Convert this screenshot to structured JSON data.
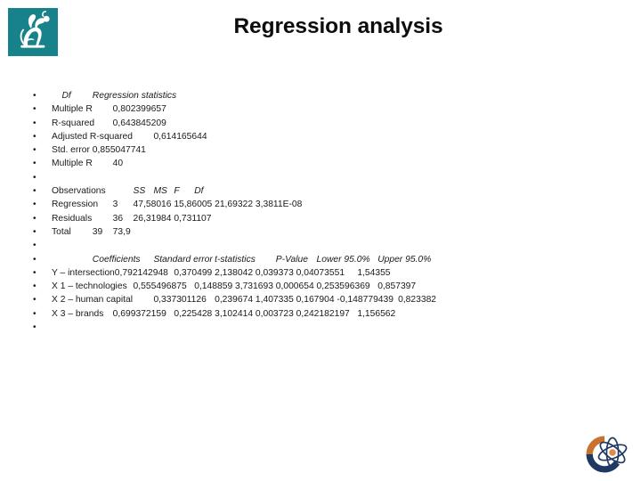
{
  "slide": {
    "title": "Regression analysis",
    "bullet_glyph": "•",
    "brand_logo_name": "griffin-logo",
    "brand_logo_color": "#17828a",
    "corner_logo_name": "atom-circle-logo",
    "corner_logo_colors": {
      "arc_top": "#c8722e",
      "arc_bottom": "#1f3864",
      "nucleus": "#e08a4e"
    },
    "title_color": "#0d0d0d",
    "text_color": "#1a1a1a",
    "background": "#ffffff"
  },
  "content": {
    "rows": [
      {
        "id": "stats-header",
        "style": "italic",
        "text": "    Df\tRegression statistics"
      },
      {
        "id": "multiple-r",
        "style": "normal",
        "text": "Multiple R\t0,802399657"
      },
      {
        "id": "r-squared",
        "style": "normal",
        "text": "R-squared\t0,643845209"
      },
      {
        "id": "adjusted-r-squared",
        "style": "normal",
        "text": "Adjusted R-squared\t0,614165644"
      },
      {
        "id": "std-error",
        "style": "normal",
        "text": "Std. error\t0,855047741"
      },
      {
        "id": "multiple-r-count",
        "style": "normal",
        "text": "Multiple R\t40"
      },
      {
        "id": "spacer-1",
        "style": "normal",
        "text": ""
      },
      {
        "id": "anova-header",
        "style": "mixed",
        "segments": [
          {
            "text": "Observations\t\t",
            "italic": false
          },
          {
            "text": "SS\tMS\tF\tDf",
            "italic": true
          }
        ],
        "text": "Observations\t\tSS\tMS\tF\tDf"
      },
      {
        "id": "anova-regression",
        "style": "normal",
        "text": "Regression\t3\t47,58016\t15,86005\t21,69322\t3,3811E-08"
      },
      {
        "id": "anova-residuals",
        "style": "normal",
        "text": "Residuals\t36\t26,31984\t0,731107"
      },
      {
        "id": "anova-total",
        "style": "normal",
        "text": "Total\t39\t73,9"
      },
      {
        "id": "spacer-2",
        "style": "normal",
        "text": ""
      },
      {
        "id": "coef-header",
        "style": "italic",
        "text": "\t\tCoefficients\tStandard error\tt-statistics\tP-Value\tLower 95.0%\tUpper 95.0%"
      },
      {
        "id": "coef-intersection",
        "style": "normal",
        "text": "Y – intersection0,792142948\t0,370499\t2,138042\t0,039373\t0,04073551\t1,54355"
      },
      {
        "id": "coef-x1",
        "style": "normal",
        "text": "X 1 – technologies\t0,555496875\t0,148859\t3,731693\t0,000654\t0,253596369\t0,857397"
      },
      {
        "id": "coef-x2",
        "style": "normal",
        "text": "X 2 – human capital\t0,337301126\t0,239674\t1,407335\t0,167904\t-0,148779439\t0,823382"
      },
      {
        "id": "coef-x3",
        "style": "normal",
        "text": "X 3 – brands\t0,699372159\t0,225428\t3,102414\t0,003723\t0,242182197\t1,156562"
      },
      {
        "id": "spacer-3",
        "style": "normal",
        "text": ""
      }
    ]
  }
}
